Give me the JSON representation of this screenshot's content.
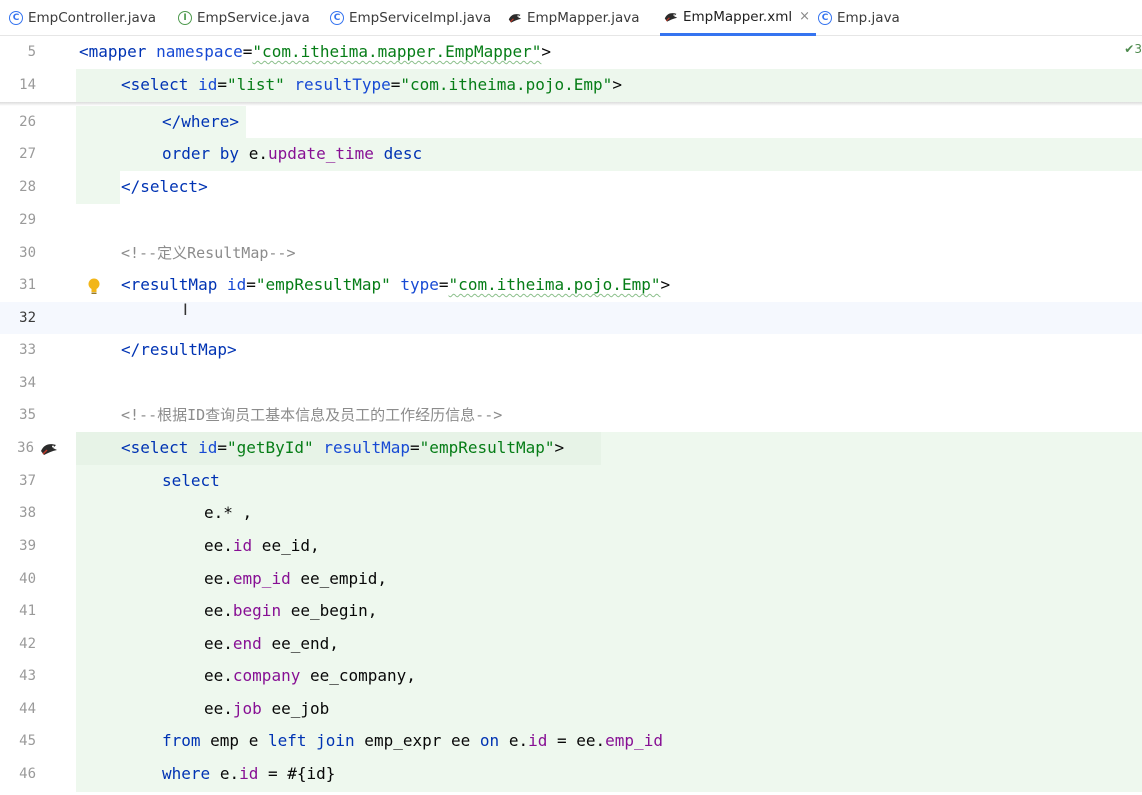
{
  "tabs": [
    {
      "label": "EmpController.java",
      "icon": "class-icon",
      "active": false
    },
    {
      "label": "EmpService.java",
      "icon": "interface-icon",
      "active": false
    },
    {
      "label": "EmpServiceImpl.java",
      "icon": "class-icon",
      "active": false
    },
    {
      "label": "EmpMapper.java",
      "icon": "mybatis-bird-icon",
      "active": false
    },
    {
      "label": "EmpMapper.xml",
      "icon": "mybatis-bird-icon",
      "active": true,
      "close": "×"
    },
    {
      "label": "Emp.java",
      "icon": "class-icon",
      "active": false
    }
  ],
  "inspections": {
    "text": "3"
  },
  "lines": {
    "l5": {
      "num": "5"
    },
    "l14": {
      "num": "14"
    },
    "l26": {
      "num": "26"
    },
    "l27": {
      "num": "27"
    },
    "l28": {
      "num": "28"
    },
    "l29": {
      "num": "29"
    },
    "l30": {
      "num": "30",
      "text": "<!--定义ResultMap-->"
    },
    "l31": {
      "num": "31"
    },
    "l32": {
      "num": "32"
    },
    "l33": {
      "num": "33"
    },
    "l34": {
      "num": "34"
    },
    "l35": {
      "num": "35",
      "text": "<!--根据ID查询员工基本信息及员工的工作经历信息-->"
    },
    "l36": {
      "num": "36"
    },
    "l37": {
      "num": "37",
      "text": "select"
    },
    "l38": {
      "num": "38",
      "text": "e.* ,"
    },
    "l39": {
      "num": "39"
    },
    "l40": {
      "num": "40"
    },
    "l41": {
      "num": "41"
    },
    "l42": {
      "num": "42"
    },
    "l43": {
      "num": "43"
    },
    "l44": {
      "num": "44"
    },
    "l45": {
      "num": "45"
    },
    "l46": {
      "num": "46"
    }
  },
  "code": {
    "mapper_tag": "<mapper",
    "namespace_attr": "namespace",
    "namespace_val": "\"com.itheima.mapper.EmpMapper\"",
    "select_tag": "<select",
    "id_attr": "id",
    "list_val": "\"list\"",
    "resultType_attr": "resultType",
    "resultType_val": "\"com.itheima.pojo.Emp\"",
    "where_close": "</where>",
    "order_by": "order by",
    "e_dot": "e.",
    "update_time": "update_time",
    "desc": "desc",
    "select_close": "</select>",
    "resultMap_tag": "<resultMap",
    "empResultMap_val": "\"empResultMap\"",
    "type_attr": "type",
    "type_val": "\"com.itheima.pojo.Emp\"",
    "resultMap_close": "</resultMap>",
    "getById_val": "\"getById\"",
    "resultMap_attr": "resultMap",
    "ee_dot": "ee.",
    "id": "id",
    "ee_id": " ee_id,",
    "emp_id": "emp_id",
    "ee_empid": " ee_empid,",
    "begin": "begin",
    "ee_begin": " ee_begin,",
    "end": "end",
    "ee_end": " ee_end,",
    "company": "company",
    "ee_company": " ee_company,",
    "job": "job",
    "ee_job": " ee_job",
    "from": "from",
    "emp_e": " emp e ",
    "left_join": "left join",
    "emp_expr_ee": " emp_expr ee ",
    "on": "on",
    "eq": " = ",
    "where": "where",
    "eq_param": " = #{id}"
  }
}
